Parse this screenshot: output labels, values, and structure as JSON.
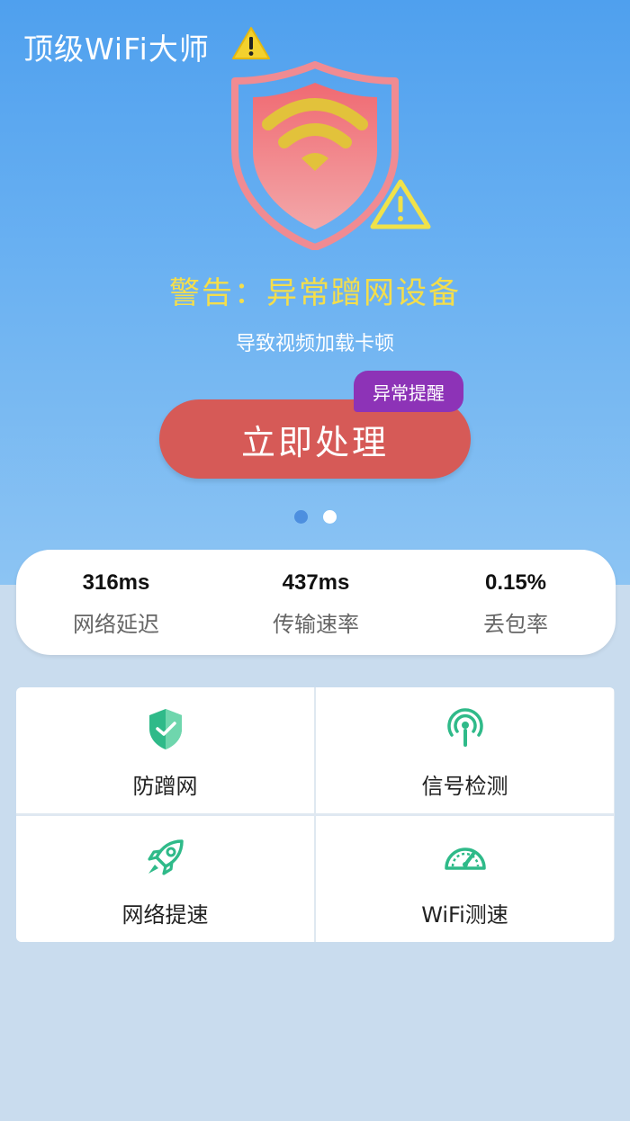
{
  "header": {
    "app_title": "顶级WiFi大师"
  },
  "hero": {
    "warning_title": "警告：异常蹭网设备",
    "warning_subtitle": "导致视频加载卡顿",
    "action_button": "立即处理",
    "badge": "异常提醒",
    "carousel": {
      "pages": 2,
      "active_page": 1
    }
  },
  "stats": [
    {
      "value": "316ms",
      "label": "网络延迟"
    },
    {
      "value": "437ms",
      "label": "传输速率"
    },
    {
      "value": "0.15%",
      "label": "丢包率"
    }
  ],
  "tools": [
    {
      "label": "防蹭网",
      "icon": "shield-check-icon"
    },
    {
      "label": "信号检测",
      "icon": "signal-tower-icon"
    },
    {
      "label": "网络提速",
      "icon": "rocket-icon"
    },
    {
      "label": "WiFi测速",
      "icon": "speedometer-icon"
    }
  ],
  "colors": {
    "warning_yellow": "#f4de4c",
    "action_red": "#d65a57",
    "badge_purple": "#8d33b7",
    "icon_green": "#2fba89"
  }
}
